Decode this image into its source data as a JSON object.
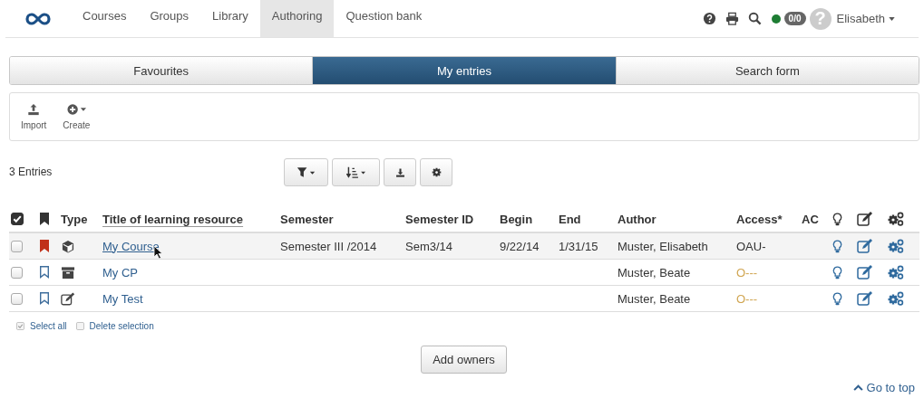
{
  "nav": {
    "items": [
      {
        "label": "Courses",
        "selected": false
      },
      {
        "label": "Groups",
        "selected": false
      },
      {
        "label": "Library",
        "selected": false
      },
      {
        "label": "Authoring",
        "selected": true
      },
      {
        "label": "Question bank",
        "selected": false
      }
    ],
    "status_online": true,
    "badge": "0/0",
    "avatar_glyph": "?",
    "user": "Elisabeth"
  },
  "tabs": [
    {
      "label": "Favourites",
      "selected": false
    },
    {
      "label": "My entries",
      "selected": true
    },
    {
      "label": "Search form",
      "selected": false
    }
  ],
  "toolbar": [
    {
      "kind": "import",
      "label": "Import"
    },
    {
      "kind": "create",
      "label": "Create"
    }
  ],
  "count": "3 Entries",
  "table": {
    "select_all_checked": true,
    "columns": [
      "Type",
      "Title of learning resource",
      "Semester",
      "Semester ID",
      "Begin",
      "End",
      "Author",
      "Access*",
      "AC"
    ],
    "rows": [
      {
        "checked": false,
        "bookmarked": true,
        "highlighted": true,
        "kind": "course",
        "title": "My Course",
        "semester": "Semester III /2014",
        "semester_id": "Sem3/14",
        "begin": "9/22/14",
        "end": "1/31/15",
        "author": "Muster, Elisabeth",
        "access": {
          "text": "OAU-",
          "color": "#333333"
        }
      },
      {
        "checked": false,
        "bookmarked": false,
        "highlighted": false,
        "kind": "cp",
        "title": "My CP",
        "author": "Muster, Beate",
        "access": {
          "text": "O---",
          "color": "#d0a550"
        }
      },
      {
        "checked": false,
        "bookmarked": false,
        "highlighted": false,
        "kind": "test",
        "title": "My Test",
        "author": "Muster, Beate",
        "access": {
          "text": "O---",
          "color": "#d0a550"
        }
      }
    ]
  },
  "select_all": "Select all",
  "delete_selection": "Delete selection",
  "add_owners": "Add owners",
  "go_to_top": "Go to top"
}
